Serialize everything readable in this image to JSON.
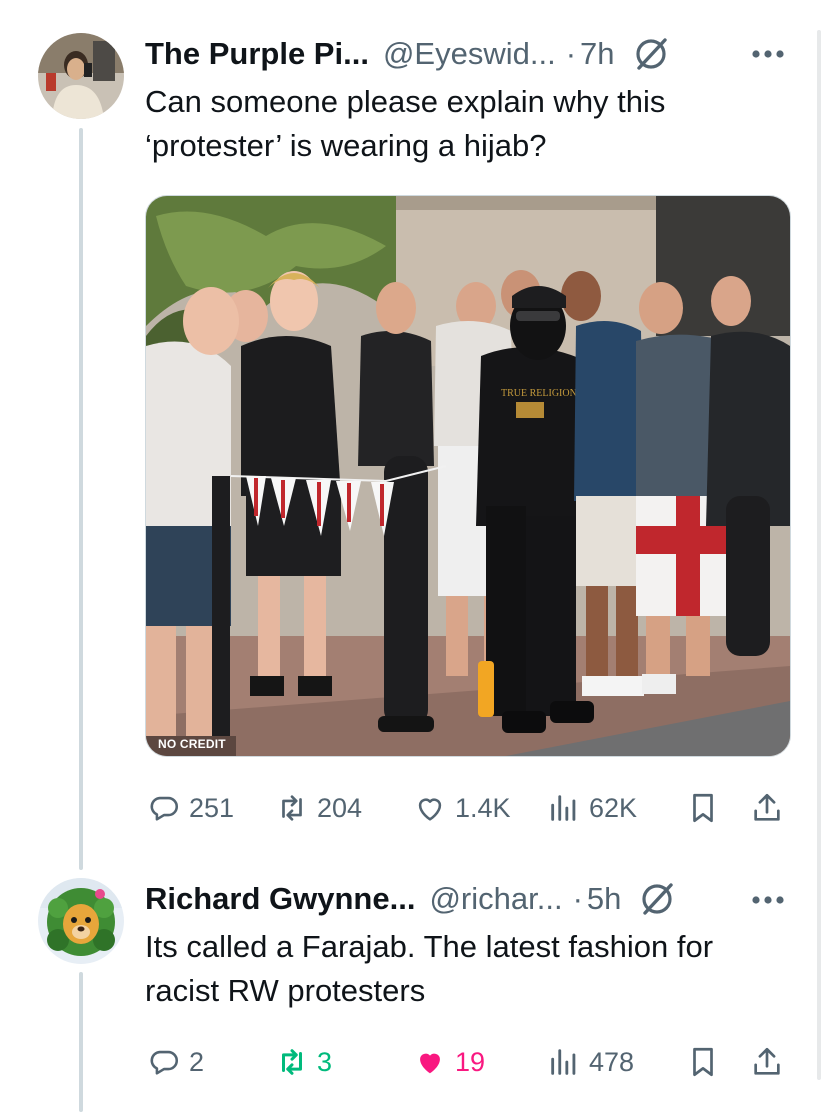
{
  "tweets": [
    {
      "name": "The Purple Pi...",
      "handle": "@Eyeswid...",
      "dot": "·",
      "time": "7h",
      "text": "Can someone please explain why this ‘protester’ is wearing a hijab?",
      "media": {
        "watermark": "NO CREDIT"
      },
      "stats": {
        "replies": "251",
        "reposts": "204",
        "likes": "1.4K",
        "views": "62K"
      },
      "liked": false
    },
    {
      "name": "Richard Gwynne...",
      "handle": "@richar...",
      "dot": "·",
      "time": "5h",
      "text": "Its called a Farajab. The latest fashion for racist RW protesters",
      "stats": {
        "replies": "2",
        "reposts": "3",
        "likes": "19",
        "views": "478"
      },
      "liked": true
    }
  ],
  "colors": {
    "text": "#0f1419",
    "secondary": "#536471",
    "repost_active": "#00ba7c",
    "like_active": "#f91880",
    "thread_line": "#cfd9de"
  },
  "icons": [
    "reply-icon",
    "repost-icon",
    "like-icon",
    "views-icon",
    "bookmark-icon",
    "share-icon",
    "more-icon",
    "verified-off-icon"
  ]
}
